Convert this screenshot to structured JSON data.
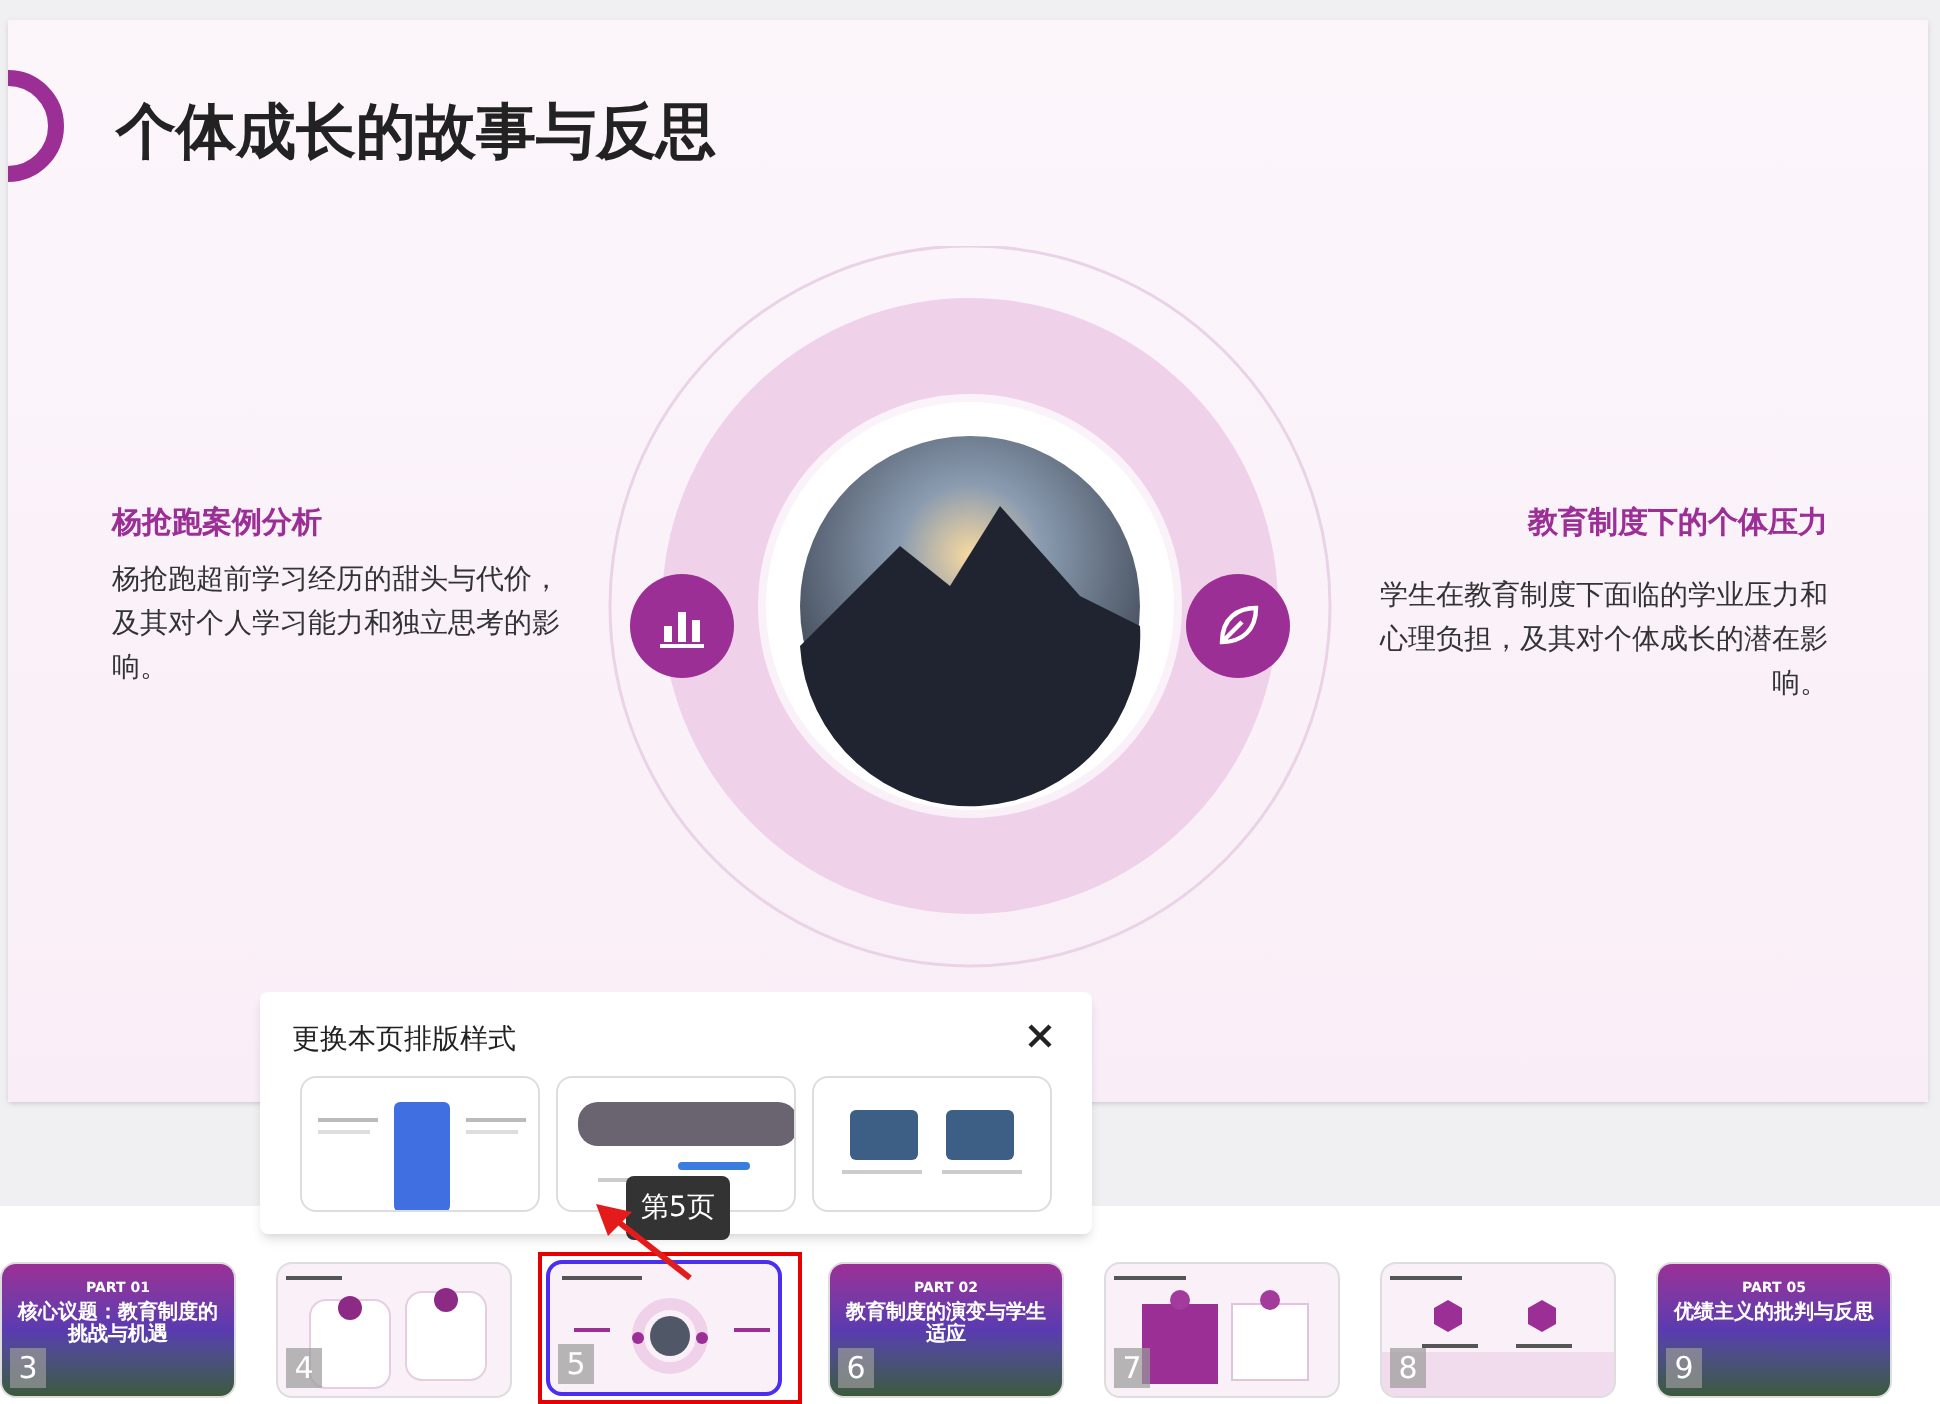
{
  "slide": {
    "title": "个体成长的故事与反思",
    "left_point": {
      "heading": "杨抢跑案例分析",
      "body": "杨抢跑超前学习经历的甜头与代价，及其对个人学习能力和独立思考的影响。"
    },
    "right_point": {
      "heading": "教育制度下的个体压力",
      "body": "学生在教育制度下面临的学业压力和心理负担，及其对个体成长的潜在影响。"
    }
  },
  "layout_popup": {
    "title": "更换本页排版样式",
    "options": [
      {
        "kind": "wave"
      },
      {
        "kind": "city"
      },
      {
        "kind": "cards"
      }
    ]
  },
  "tooltip": "第5页",
  "thumbnails": [
    {
      "number": "3",
      "kind": "section",
      "selected": false,
      "part": "PART 01",
      "title": "核心议题：教育制度的挑战与机遇"
    },
    {
      "number": "4",
      "kind": "two-cards",
      "selected": false
    },
    {
      "number": "5",
      "kind": "ring",
      "selected": true
    },
    {
      "number": "6",
      "kind": "section",
      "selected": false,
      "part": "PART 02",
      "title": "教育制度的演变与学生适应"
    },
    {
      "number": "7",
      "kind": "boxes",
      "selected": false
    },
    {
      "number": "8",
      "kind": "hexagons",
      "selected": false
    },
    {
      "number": "9",
      "kind": "section",
      "selected": false,
      "part": "PART 05",
      "title": "优绩主义的批判与反思"
    }
  ]
}
